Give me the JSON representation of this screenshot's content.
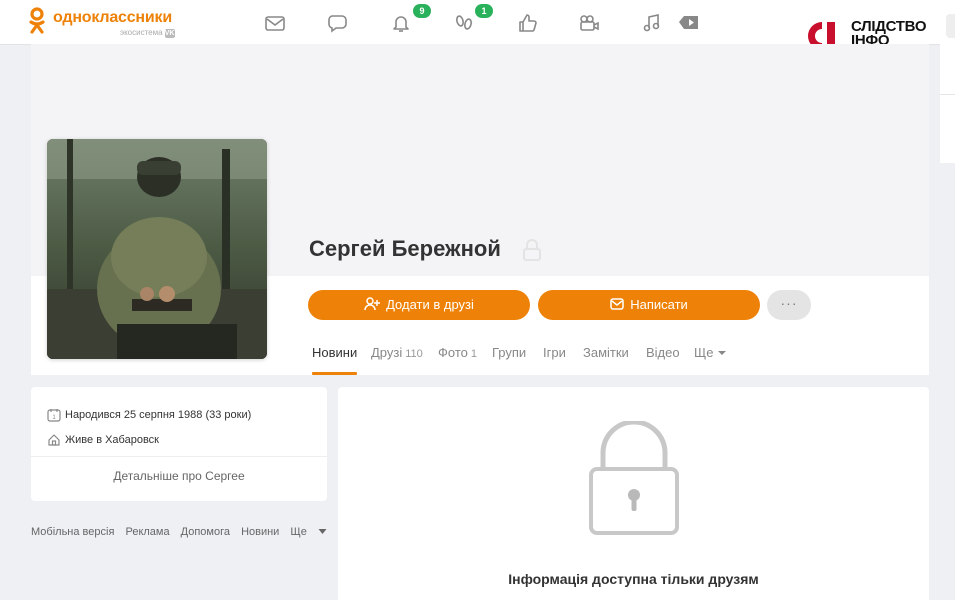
{
  "header": {
    "logo_text": "одноклассники",
    "logo_sub": "экосистема",
    "logo_sub_mark": "VK",
    "nav": [
      {
        "icon": "mail-icon"
      },
      {
        "icon": "chat-icon"
      },
      {
        "icon": "bell-icon",
        "badge": "9"
      },
      {
        "icon": "footprints-icon",
        "badge": "1"
      },
      {
        "icon": "like-icon"
      },
      {
        "icon": "video-camera-icon"
      },
      {
        "icon": "music-icon"
      },
      {
        "icon": "play-icon"
      }
    ]
  },
  "watermark": {
    "line1": "СЛІДСТВО",
    "line2": "ІНФО"
  },
  "profile": {
    "name": "Сергей Бережной",
    "add_friend_label": "Додати в друзі",
    "message_label": "Написати",
    "more_label": "···"
  },
  "tabs": [
    {
      "label": "Новини",
      "count": ""
    },
    {
      "label": "Друзі",
      "count": "110"
    },
    {
      "label": "Фото",
      "count": "1"
    },
    {
      "label": "Групи",
      "count": ""
    },
    {
      "label": "Ігри",
      "count": ""
    },
    {
      "label": "Замітки",
      "count": ""
    },
    {
      "label": "Відео",
      "count": ""
    },
    {
      "label": "Ще",
      "count": ""
    }
  ],
  "info": {
    "birth": "Народився 25 серпня 1988 (33 роки)",
    "lives": "Живе в Хабаровск",
    "more_link": "Детальніше про Сергее"
  },
  "footer": {
    "links": [
      "Мобільна версія",
      "Реклама",
      "Допомога",
      "Новини",
      "Ще"
    ]
  },
  "locked": {
    "message": "Інформація доступна тільки друзям"
  },
  "colors": {
    "accent": "#ee8208",
    "badge": "#2ab15b",
    "page_bg": "#eef0f3"
  }
}
